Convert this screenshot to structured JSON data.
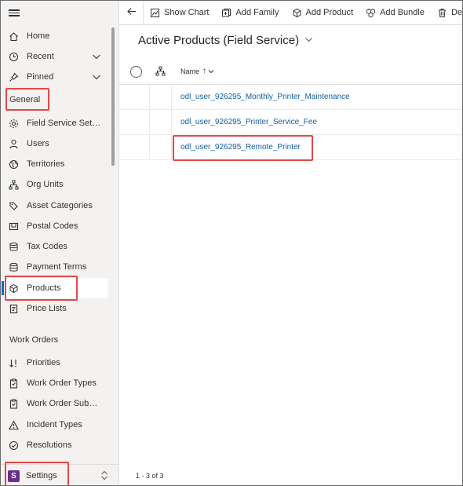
{
  "nav": {
    "home": "Home",
    "recent": "Recent",
    "pinned": "Pinned",
    "general_header": "General",
    "general_items": [
      {
        "label": "Field Service Setti...",
        "icon": "gear-icon"
      },
      {
        "label": "Users",
        "icon": "person-icon"
      },
      {
        "label": "Territories",
        "icon": "globe-icon"
      },
      {
        "label": "Org Units",
        "icon": "org-chart-icon"
      },
      {
        "label": "Asset Categories",
        "icon": "asset-category-icon"
      },
      {
        "label": "Postal Codes",
        "icon": "postal-code-icon"
      },
      {
        "label": "Tax Codes",
        "icon": "stack-icon"
      },
      {
        "label": "Payment Terms",
        "icon": "stack-icon"
      },
      {
        "label": "Products",
        "icon": "cube-icon",
        "selected": true
      },
      {
        "label": "Price Lists",
        "icon": "document-icon"
      }
    ],
    "work_orders_header": "Work Orders",
    "work_order_items": [
      {
        "label": "Priorities",
        "icon": "priority-icon"
      },
      {
        "label": "Work Order Types",
        "icon": "clipboard-icon"
      },
      {
        "label": "Work Order Subst...",
        "icon": "clipboard-icon"
      },
      {
        "label": "Incident Types",
        "icon": "warning-icon"
      },
      {
        "label": "Resolutions",
        "icon": "check-circle-icon"
      }
    ],
    "settings": {
      "badge": "S",
      "label": "Settings"
    }
  },
  "commands": {
    "show_chart": "Show Chart",
    "add_family": "Add Family",
    "add_product": "Add Product",
    "add_bundle": "Add Bundle",
    "delete": "Delet"
  },
  "view": {
    "title": "Active Products (Field Service)",
    "column_name": "Name",
    "sort_indicator": "↑",
    "rows": [
      "odl_user_926295_Monthly_Printer_Maintenance",
      "odl_user_926295_Printer_Service_Fee",
      "odl_user_926295_Remote_Printer"
    ],
    "record_count": "1 - 3 of 3"
  },
  "colors": {
    "accent": "#0f6cbd",
    "link": "#115ea3",
    "highlight": "#e34848",
    "settings_badge": "#6b2d8f"
  }
}
